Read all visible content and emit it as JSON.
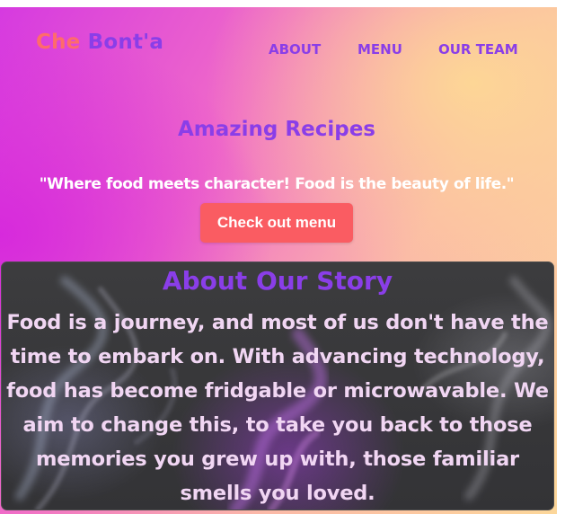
{
  "brand": {
    "part1": "Che",
    "part2": "Bont'a"
  },
  "nav": {
    "items": [
      {
        "label": "ABOUT"
      },
      {
        "label": "MENU"
      },
      {
        "label": "OUR TEAM"
      }
    ]
  },
  "hero": {
    "title": "Amazing Recipes",
    "tagline": "\"Where food meets character! Food is the beauty of life.\"",
    "cta_label": "Check out menu"
  },
  "story": {
    "title": "About Our Story",
    "body": "Food is a journey, and most of us don't have the time to embark on. With advancing technology, food has become fridgable or microwavable. We aim to change this, to take you back to those memories you grew up with, those familiar smells you loved."
  },
  "colors": {
    "accent_purple": "#8a3ee8",
    "accent_coral": "#ff6b6b",
    "button": "#fa5c62",
    "story_text": "#f1d6f3"
  }
}
